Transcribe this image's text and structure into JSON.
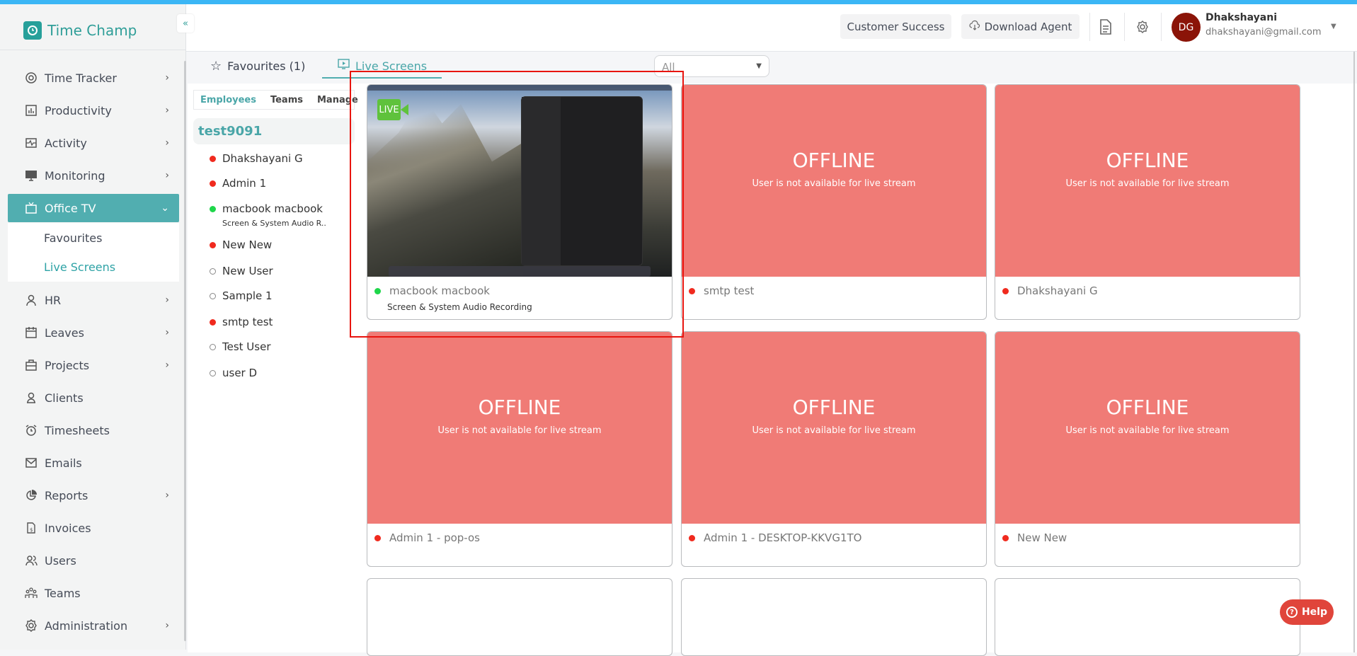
{
  "app": {
    "name": "Time Champ",
    "brand_color": "#27a09a",
    "accent": "#51aeb0"
  },
  "header": {
    "customer_success": "Customer Success",
    "download_agent": "Download Agent",
    "user": {
      "initials": "DG",
      "name": "Dhakshayani",
      "email": "dhakshayani@gmail.com"
    }
  },
  "sidebar": {
    "collapse": "«‹",
    "items": [
      {
        "label": "Time Tracker",
        "icon": "time-tracker-icon",
        "chevron": true
      },
      {
        "label": "Productivity",
        "icon": "chart-icon",
        "chevron": true
      },
      {
        "label": "Activity",
        "icon": "activity-icon",
        "chevron": true
      },
      {
        "label": "Monitoring",
        "icon": "monitor-icon",
        "chevron": true
      },
      {
        "label": "Office TV",
        "icon": "tv-icon",
        "chevron": true,
        "active": true
      },
      {
        "label": "HR",
        "icon": "person-icon",
        "chevron": true
      },
      {
        "label": "Leaves",
        "icon": "calendar-icon",
        "chevron": true
      },
      {
        "label": "Projects",
        "icon": "briefcase-icon",
        "chevron": true
      },
      {
        "label": "Clients",
        "icon": "client-icon"
      },
      {
        "label": "Timesheets",
        "icon": "alarm-icon"
      },
      {
        "label": "Emails",
        "icon": "mail-icon"
      },
      {
        "label": "Reports",
        "icon": "pie-icon",
        "chevron": true
      },
      {
        "label": "Invoices",
        "icon": "invoice-icon"
      },
      {
        "label": "Users",
        "icon": "users-icon"
      },
      {
        "label": "Teams",
        "icon": "teams-icon"
      },
      {
        "label": "Administration",
        "icon": "gear-icon",
        "chevron": true
      }
    ],
    "submenu": [
      {
        "label": "Favourites"
      },
      {
        "label": "Live Screens",
        "active": true
      }
    ]
  },
  "tabs": {
    "favourites": "Favourites (1)",
    "live_screens": "Live Screens"
  },
  "filter": {
    "selected": "All"
  },
  "employees": {
    "tabs": [
      "Employees",
      "Teams",
      "Managers"
    ],
    "group": "test9091",
    "list": [
      {
        "name": "Dhakshayani G",
        "status": "red"
      },
      {
        "name": "Admin 1",
        "status": "red"
      },
      {
        "name": "macbook macbook",
        "status": "green",
        "sub": "Screen & System Audio R.."
      },
      {
        "name": "New New",
        "status": "red"
      },
      {
        "name": "New User",
        "status": "none"
      },
      {
        "name": "Sample 1",
        "status": "none"
      },
      {
        "name": "smtp test",
        "status": "red"
      },
      {
        "name": "Test User",
        "status": "none"
      },
      {
        "name": "user D",
        "status": "none"
      }
    ]
  },
  "cards": [
    {
      "name": "macbook macbook",
      "status": "green",
      "live": true,
      "live_label": "LIVE",
      "sub": "Screen & System Audio Recording"
    },
    {
      "name": "smtp test",
      "status": "red",
      "offline": "OFFLINE",
      "offline_sub": "User is not available for live stream"
    },
    {
      "name": "Dhakshayani G",
      "status": "red",
      "offline": "OFFLINE",
      "offline_sub": "User is not available for live stream"
    },
    {
      "name": "Admin 1 - pop-os",
      "status": "red",
      "offline": "OFFLINE",
      "offline_sub": "User is not available for live stream"
    },
    {
      "name": "Admin 1 - DESKTOP-KKVG1TO",
      "status": "red",
      "offline": "OFFLINE",
      "offline_sub": "User is not available for live stream"
    },
    {
      "name": "New New",
      "status": "red",
      "offline": "OFFLINE",
      "offline_sub": "User is not available for live stream"
    }
  ],
  "help": {
    "label": "Help"
  }
}
